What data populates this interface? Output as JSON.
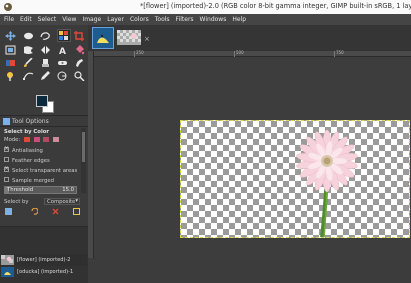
{
  "window": {
    "title": "*[flower] (imported)-2.0 (RGB color 8-bit gamma integer, GIMP built-in sRGB, 1 layer"
  },
  "menubar": {
    "items": [
      "File",
      "Edit",
      "Select",
      "View",
      "Image",
      "Layer",
      "Colors",
      "Tools",
      "Filters",
      "Windows",
      "Help"
    ]
  },
  "tool_options": {
    "header": "Tool Options",
    "tool_name": "Select by Color",
    "mode_label": "Mode:",
    "antialiasing": "Antialiasing",
    "feather_edges": "Feather edges",
    "select_transparent": "Select transparent areas",
    "sample_merged": "Sample merged",
    "threshold_label": "Threshold",
    "threshold_value": "15.0",
    "threshold_fraction": 0.06,
    "select_by_label": "Select by",
    "select_by_value": "Composite",
    "antialiasing_checked": true,
    "feather_checked": false,
    "transparent_checked": true,
    "sample_merged_checked": false
  },
  "images_list": [
    {
      "name": "[flower] (imported)-2"
    },
    {
      "name": "[oducka] (imported)-1"
    }
  ],
  "colors": {
    "foreground": "#0c2a3e",
    "background": "#ffffff",
    "selection_border": "#d9d64a",
    "tab_highlight": "#6aa0d8"
  },
  "ruler": {
    "labels": [
      "250",
      "500",
      "750"
    ]
  },
  "icons": {
    "tools": [
      "move-icon",
      "rect-select-icon",
      "lasso-icon",
      "fuzzy-select-icon",
      "crop-icon",
      "transform-icon",
      "warp-icon",
      "flip-icon",
      "text-icon",
      "paint-bucket-icon",
      "gradient-icon",
      "paintbrush-icon",
      "clone-icon",
      "heal-icon",
      "smudge-icon",
      "dodge-icon",
      "path-icon",
      "color-picker-icon",
      "measure-icon",
      "zoom-icon"
    ]
  }
}
